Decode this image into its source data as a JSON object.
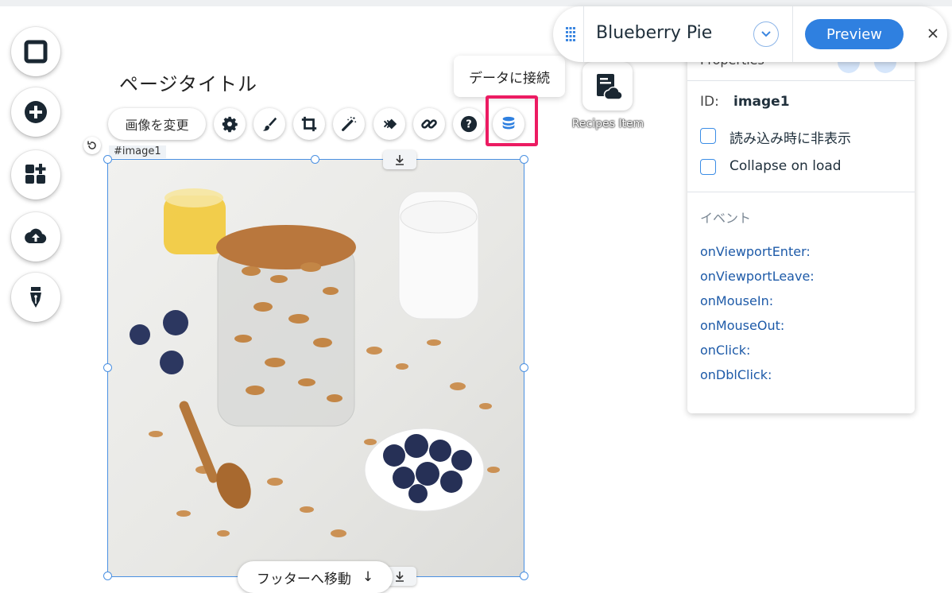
{
  "page": {
    "title": "ページタイトル"
  },
  "toolbar": {
    "change_image_label": "画像を変更",
    "tooltip": "データに接続",
    "icons": [
      "settings-icon",
      "brush-icon",
      "crop-icon",
      "magic-wand-icon",
      "animation-icon",
      "link-icon",
      "help-icon",
      "database-icon"
    ]
  },
  "element": {
    "id_label": "#image1"
  },
  "footer": {
    "move_label": "フッターへ移動",
    "arrow": "↓"
  },
  "recipes": {
    "label": "Recipes Item"
  },
  "topbar": {
    "page_name": "Blueberry Pie",
    "preview_label": "Preview",
    "close": "×"
  },
  "properties": {
    "header": "Properties",
    "id_key": "ID:",
    "id_value": "image1",
    "checkbox_hidden": "読み込み時に非表示",
    "checkbox_collapse": "Collapse on load",
    "events_title": "イベント",
    "events": [
      "onViewportEnter:",
      "onViewportLeave:",
      "onMouseIn:",
      "onMouseOut:",
      "onClick:",
      "onDblClick:"
    ]
  },
  "colors": {
    "accent": "#2f80e0",
    "highlight": "#ec1b62",
    "selection": "#4a90e2"
  }
}
